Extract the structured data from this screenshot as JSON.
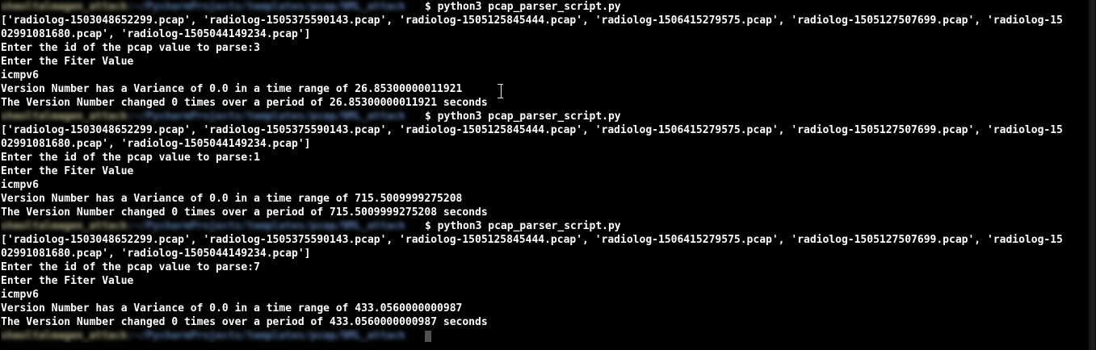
{
  "terminal": {
    "prompt_cmd": "python3 pcap_parser_script.py",
    "list_line1": "['radiolog-1503048652299.pcap', 'radiolog-1505375590143.pcap', 'radiolog-1505125845444.pcap', 'radiolog-1506415279575.pcap', 'radiolog-1505127507699.pcap', 'radiolog-15",
    "list_line2": "02991081680.pcap', 'radiolog-1505044149234.pcap']",
    "prompt_enter_id": "Enter the id of the pcap value to parse:",
    "prompt_filter": "Enter the Fiter Value",
    "runs": [
      {
        "id_value": "3",
        "filter_value": "icmpv6",
        "variance_line": "Version Number has a Variance of 0.0 in a time range of 26.85300000011921",
        "changed_line_a": "The Version Number changed 0 times over a period of 26.85300000011921 second",
        "changed_line_b": "s"
      },
      {
        "id_value": "1",
        "filter_value": "icmpv6",
        "variance_line": "Version Number has a Variance of 0.0 in a time range of 715.5009999275208",
        "changed_line_a": "The Version Number changed 0 times over a period of 715.5009999275208 seconds",
        "changed_line_b": ""
      },
      {
        "id_value": "7",
        "filter_value": "icmpv6",
        "variance_line": "Version Number has a Variance of 0.0 in a time range of 433.0560000000987",
        "changed_line_a": "The Version Number changed 0 times over a period of 433.056000000098",
        "changed_cursor_char": "7",
        "changed_line_c": " seconds"
      }
    ],
    "redacted_prompt": {
      "user": "shaultalmagen_attack",
      "path": ":~/PycharmProjects/templates/pcap/NML_attack",
      "dollar": "$"
    }
  },
  "colors": {
    "background": "#000000",
    "foreground": "#ffffff",
    "redacted_user": "#b5b08a",
    "redacted_path": "#5f7fb0"
  }
}
